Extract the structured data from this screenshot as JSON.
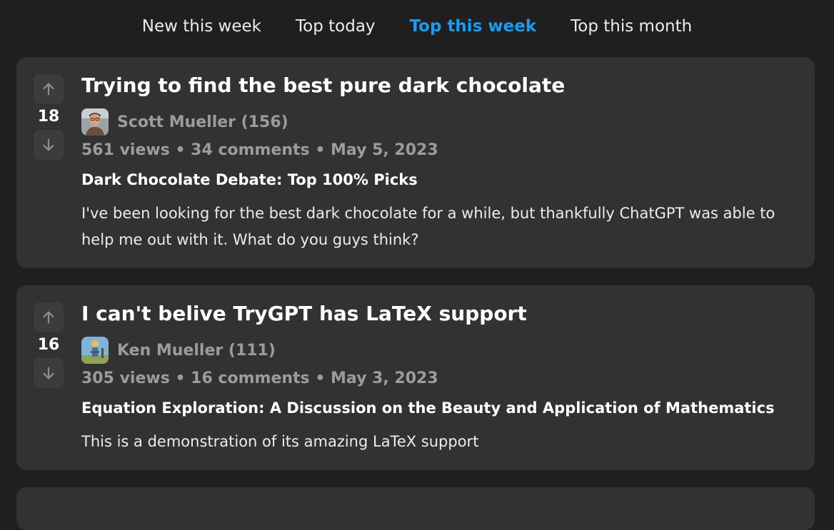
{
  "tabs": [
    {
      "label": "New this week",
      "active": false
    },
    {
      "label": "Top today",
      "active": false
    },
    {
      "label": "Top this week",
      "active": true
    },
    {
      "label": "Top this month",
      "active": false
    }
  ],
  "colors": {
    "background": "#1f1f21",
    "card": "#323234",
    "accent": "#1d9bf0",
    "muted": "#9c9c9e"
  },
  "posts": [
    {
      "votes": "18",
      "title": "Trying to find the best pure dark chocolate",
      "author": "Scott Mueller (156)",
      "avatar_icon": "user-avatar-icon",
      "stats": "561 views • 34 comments • May 5, 2023",
      "subtitle": "Dark Chocolate Debate: Top 100% Picks",
      "body": "I've been looking for the best dark chocolate for a while, but thankfully ChatGPT was able to help me out with it. What do you guys think?"
    },
    {
      "votes": "16",
      "title": "I can't belive TryGPT has LaTeX support",
      "author": "Ken Mueller (111)",
      "avatar_icon": "user-avatar-icon",
      "stats": "305 views • 16 comments • May 3, 2023",
      "subtitle": "Equation Exploration: A Discussion on the Beauty and Application of Mathematics",
      "body": "This is a demonstration of its amazing LaTeX support"
    }
  ]
}
